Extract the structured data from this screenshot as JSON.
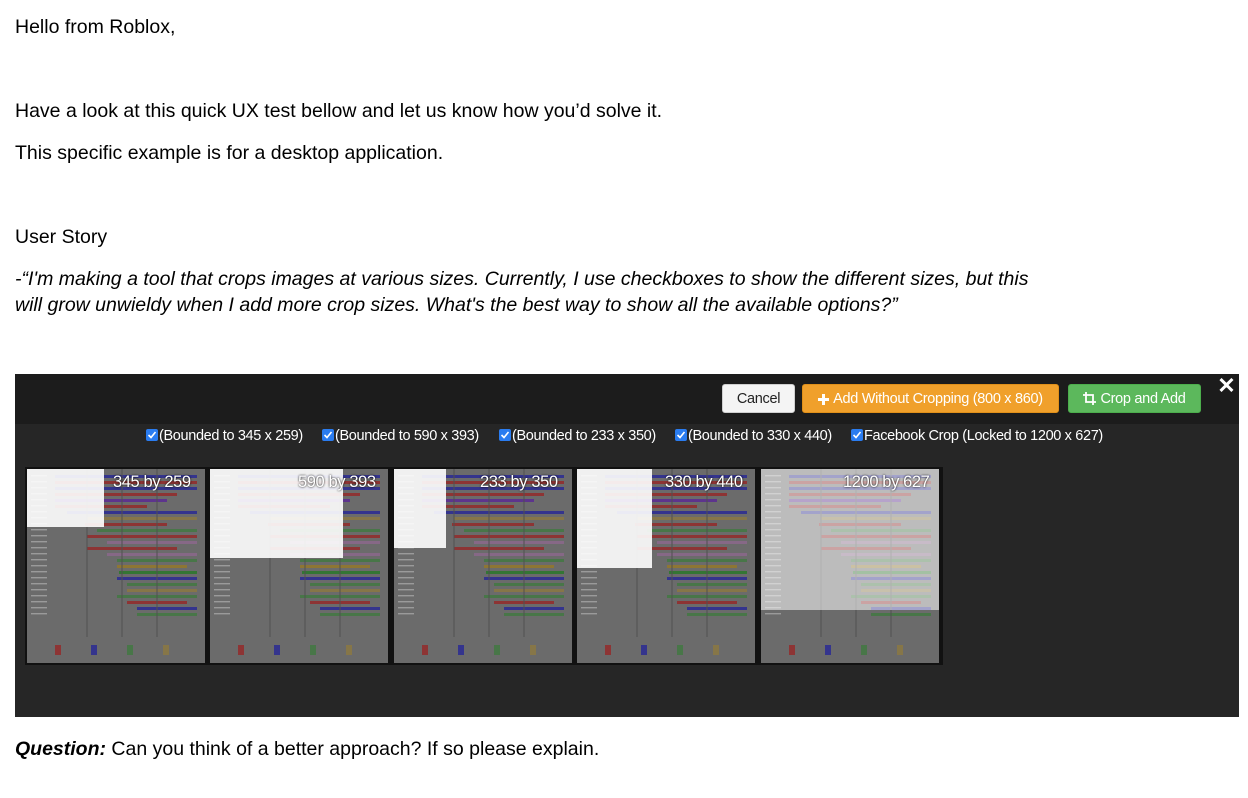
{
  "greeting": "Hello from Roblox,",
  "intro_line1": "Have a look at this quick UX test bellow and let us know how you’d solve it.",
  "intro_line2": "This specific example is for a desktop application.",
  "story_heading": "User Story",
  "story_quote_line1": "-“I'm making a tool that crops images at various sizes. Currently, I use checkboxes to show the different sizes, but this",
  "story_quote_line2": "will grow unwieldy when I add more crop sizes. What's the best way to show all the available options?”",
  "screenshot": {
    "buttons": {
      "cancel": "Cancel",
      "add_without_cropping": "Add Without Cropping (800 x 860)",
      "crop_and_add": "Crop and Add",
      "close": "✕"
    },
    "options": [
      {
        "label": "(Bounded to 345 x 259)",
        "checked": true
      },
      {
        "label": "(Bounded to 590 x 393)",
        "checked": true
      },
      {
        "label": "(Bounded to 233 x 350)",
        "checked": true
      },
      {
        "label": "(Bounded to 330 x 440)",
        "checked": true
      },
      {
        "label": "Facebook Crop (Locked to 1200 x 627)",
        "checked": true
      }
    ],
    "thumbnails": [
      {
        "caption": "345 by 259"
      },
      {
        "caption": "590 by 393"
      },
      {
        "caption": "233 by 350"
      },
      {
        "caption": "330 by 440"
      },
      {
        "caption": "1200 by 627"
      }
    ],
    "colors": {
      "orange": "#f0a02b",
      "green": "#5cb85c",
      "checkbox": "#2a7cf0",
      "panel": "#262626"
    }
  },
  "question_label": "Question:",
  "question_text": " Can you think of a better approach? If so please explain."
}
